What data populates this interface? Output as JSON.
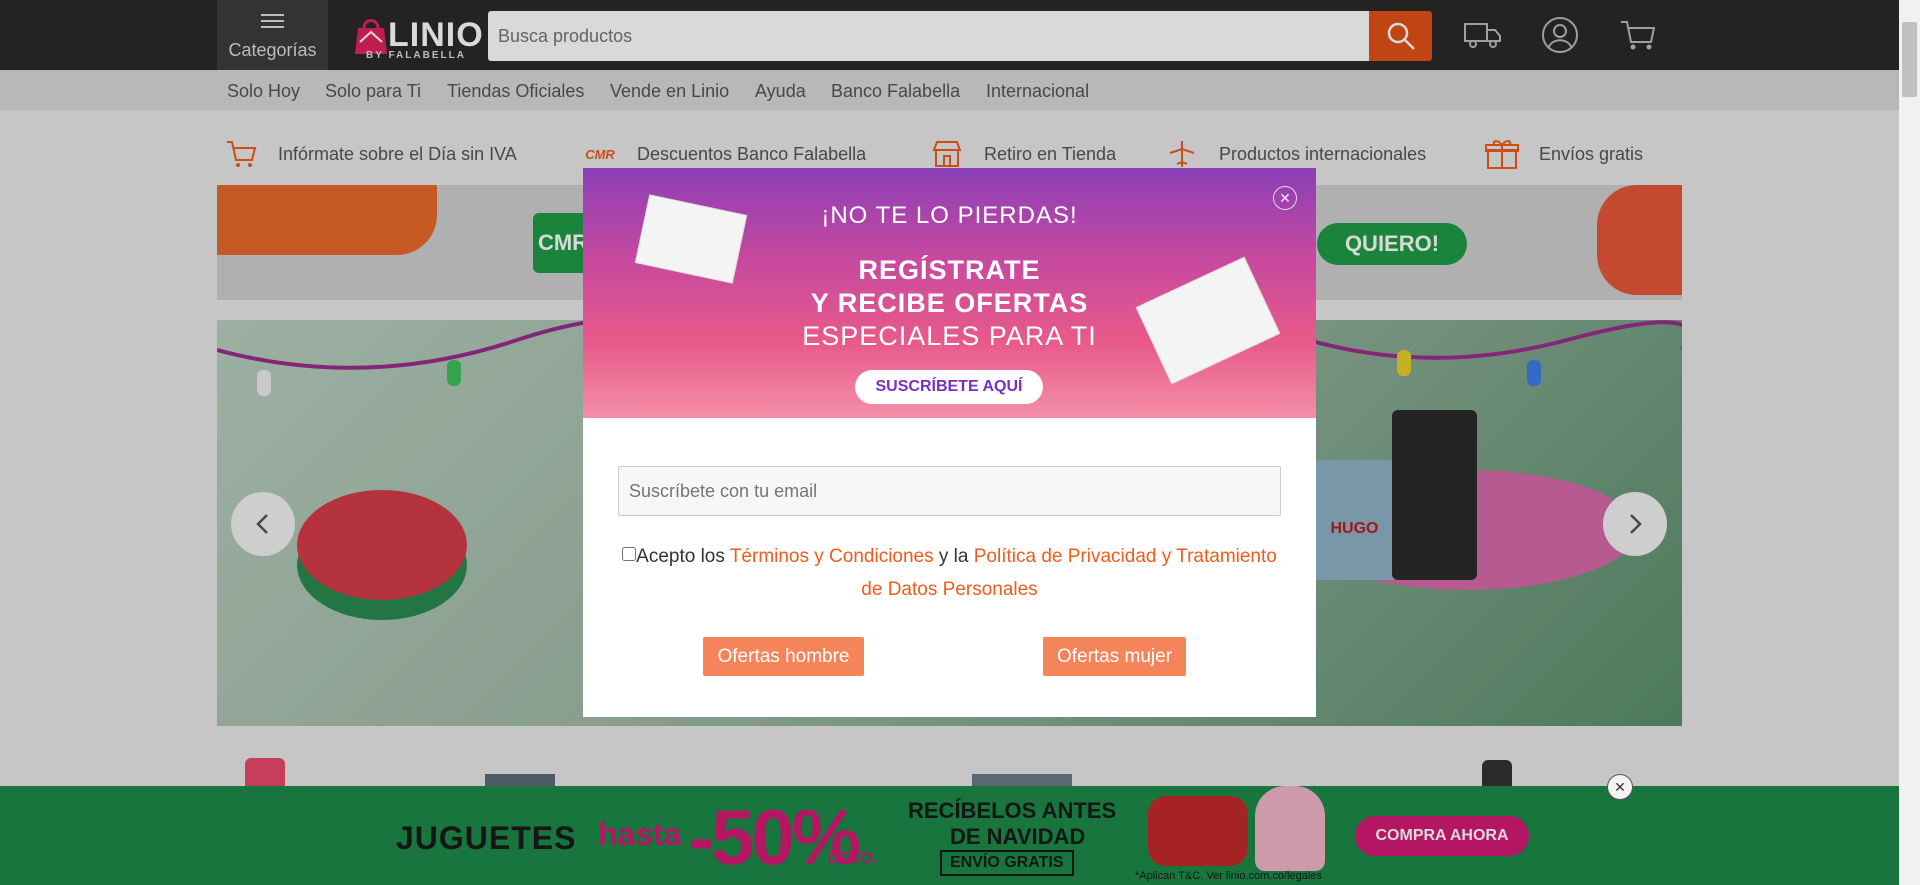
{
  "header": {
    "categories_label": "Categorías",
    "logo_word": "LINIO",
    "logo_sub": "BY FALABELLA",
    "search_placeholder": "Busca productos"
  },
  "nav": {
    "items": [
      "Solo Hoy",
      "Solo para Ti",
      "Tiendas Oficiales",
      "Vende en Linio",
      "Ayuda",
      "Banco Falabella",
      "Internacional"
    ]
  },
  "benefits": [
    {
      "label": "Infórmate sobre el Día sin IVA",
      "icon": "cart-icon"
    },
    {
      "label": "Descuentos Banco Falabella",
      "icon": "cmr-icon"
    },
    {
      "label": "Retiro en Tienda",
      "icon": "store-icon"
    },
    {
      "label": "Productos internacionales",
      "icon": "plane-icon"
    },
    {
      "label": "Envíos gratis",
      "icon": "gift-icon"
    }
  ],
  "modal": {
    "headline": "¡NO TE LO PIERDAS!",
    "line1": "REGÍSTRATE",
    "line2": "Y RECIBE OFERTAS",
    "line3": "ESPECIALES PARA TI",
    "cta": "SUSCRÍBETE AQUÍ",
    "email_placeholder": "Suscríbete con tu email",
    "terms_prefix": "Acepto los ",
    "terms_link1": "Términos y Condiciones",
    "terms_mid": " y la ",
    "terms_link2": "Política de Privacidad y Tratamiento de Datos Personales",
    "btn_men": "Ofertas hombre",
    "btn_women": "Ofertas mujer"
  },
  "bottom_banner": {
    "word": "JUGUETES",
    "hasta": "hasta",
    "discount": "-50%",
    "dcto": "DCTO.",
    "headline1": "RECÍBELOS ANTES",
    "headline2": "DE NAVIDAD",
    "envio": "ENVÍO GRATIS",
    "cta": "COMPRA AHORA",
    "legal": "*Aplican T&C. Ver linio.com.co/legales"
  },
  "promo_strip": {
    "quiero": "QUIERO!",
    "cmr": "CMR"
  },
  "hero": {
    "brand": "HUGO"
  },
  "colors": {
    "accent": "#f15b1c",
    "topbar": "#2a2a2a",
    "cta_purple": "#7a2fc4"
  }
}
